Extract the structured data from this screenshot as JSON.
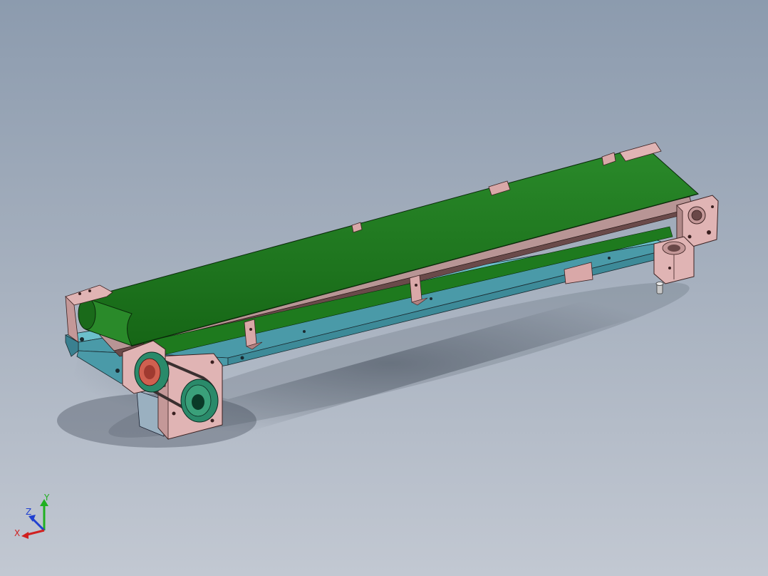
{
  "viewport": {
    "background_top": "#8c9bae",
    "background_bottom": "#c2c8d2"
  },
  "model": {
    "belt_color": "#1e7a1e",
    "frame_color": "#4a9aa8",
    "bracket_color": "#d9a8a8",
    "pulley_color": "#2a8a6a",
    "roller_accent": "#d06050",
    "motor_color": "#9ab0c0"
  },
  "triad": {
    "x_label": "X",
    "y_label": "Y",
    "z_label": "Z",
    "x_color": "#d02020",
    "y_color": "#20b020",
    "z_color": "#2040d0"
  }
}
